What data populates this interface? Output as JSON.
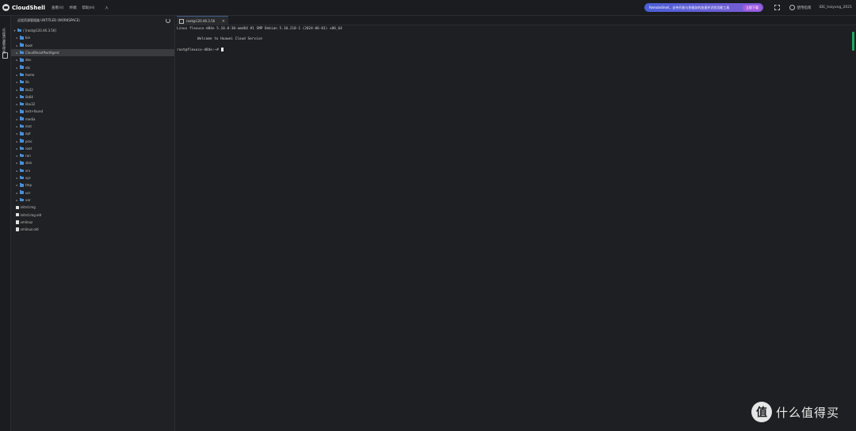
{
  "app": {
    "name": "CloudShell"
  },
  "menu": [
    "查看(V)",
    "终端",
    "帮助(H)",
    "入"
  ],
  "banner": {
    "text": "RemoteShell，支持开放与多服务的加速并识别功能工具",
    "button": "立即下载"
  },
  "header_right": {
    "feedback": "使用指南",
    "user": "IDE_haiyong_2021"
  },
  "activity": {
    "label": "远程资源管理器"
  },
  "sidebar": {
    "title": "远程资源管理器 UNTITLED (WORKSPACE)",
    "root": "/ [root@120.46.3.56]",
    "items": [
      {
        "name": "bin",
        "type": "folder"
      },
      {
        "name": "boot",
        "type": "folder"
      },
      {
        "name": "CloudResetPwdAgent",
        "type": "folder",
        "selected": true
      },
      {
        "name": "dev",
        "type": "folder"
      },
      {
        "name": "etc",
        "type": "folder"
      },
      {
        "name": "home",
        "type": "folder"
      },
      {
        "name": "lib",
        "type": "folder"
      },
      {
        "name": "lib32",
        "type": "folder"
      },
      {
        "name": "lib64",
        "type": "folder"
      },
      {
        "name": "libx32",
        "type": "folder"
      },
      {
        "name": "lost+found",
        "type": "folder"
      },
      {
        "name": "media",
        "type": "folder"
      },
      {
        "name": "mnt",
        "type": "folder"
      },
      {
        "name": "opt",
        "type": "folder"
      },
      {
        "name": "proc",
        "type": "folder"
      },
      {
        "name": "root",
        "type": "folder"
      },
      {
        "name": "run",
        "type": "folder"
      },
      {
        "name": "sbin",
        "type": "folder"
      },
      {
        "name": "srv",
        "type": "folder"
      },
      {
        "name": "sys",
        "type": "folder"
      },
      {
        "name": "tmp",
        "type": "folder"
      },
      {
        "name": "usr",
        "type": "folder"
      },
      {
        "name": "var",
        "type": "folder"
      },
      {
        "name": "initrd.img",
        "type": "file"
      },
      {
        "name": "initrd.img.old",
        "type": "file"
      },
      {
        "name": "vmlinuz",
        "type": "file"
      },
      {
        "name": "vmlinuz.old",
        "type": "file"
      }
    ]
  },
  "tab": {
    "label": "root@120.46.3.56"
  },
  "terminal": {
    "line1": "Linux flexusx-d84e 5.10.0-30-amd64 #1 SMP Debian 5.10.218-1 (2024-06-01) x86_64",
    "line2": "Welcome to Huawei Cloud Service",
    "prompt": "root@flexusx-d84e:~# "
  },
  "watermark": {
    "symbol": "值",
    "text": "什么值得买"
  },
  "colors": {
    "accent": "#4a8fd6",
    "scrollbar": "#1fa860",
    "banner": "#4a5fd6"
  }
}
